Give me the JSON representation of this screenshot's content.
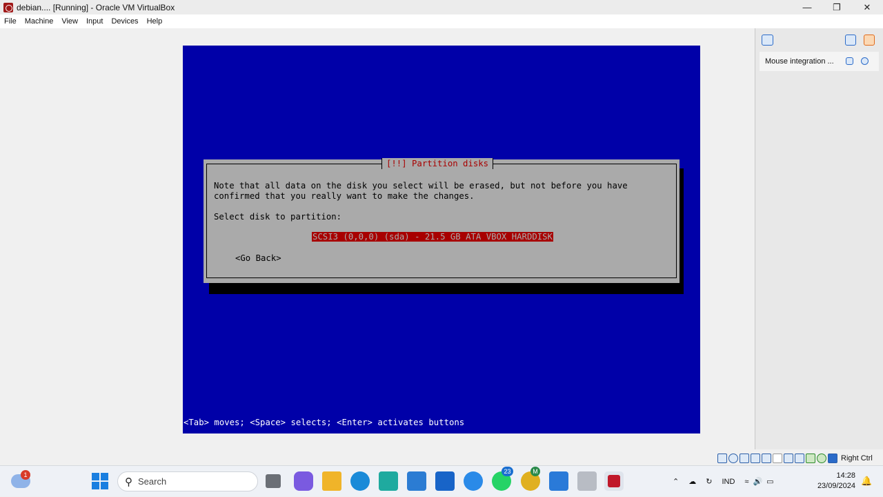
{
  "window": {
    "title": "debian.... [Running] - Oracle VM VirtualBox",
    "minimize_glyph": "—",
    "restore_glyph": "❐",
    "close_glyph": "✕"
  },
  "menu": [
    "File",
    "Machine",
    "View",
    "Input",
    "Devices",
    "Help"
  ],
  "installer": {
    "dialog_title": "[!!] Partition disks",
    "line1": "Note that all data on the disk you select will be erased, but not before you have",
    "line2": "confirmed that you really want to make the changes.",
    "prompt": "Select disk to partition:",
    "disk_option": "SCSI3 (0,0,0) (sda) - 21.5 GB ATA VBOX HARDDISK",
    "go_back": "<Go Back>",
    "status_line": "<Tab> moves; <Space> selects; <Enter> activates buttons"
  },
  "side_panel": {
    "notification": "Mouse integration ..."
  },
  "statusbar": {
    "host_key": "Right Ctrl"
  },
  "taskbar": {
    "weather_badge": "1",
    "search_placeholder": "Search",
    "whatsapp_badge": "23",
    "chrome_badge": "M",
    "language": "IND",
    "time": "14:28",
    "date": "23/09/2024"
  },
  "colors": {
    "vm_blue": "#0000a8",
    "dialog_gray": "#aaaaaa",
    "highlight_red": "#a80000"
  }
}
